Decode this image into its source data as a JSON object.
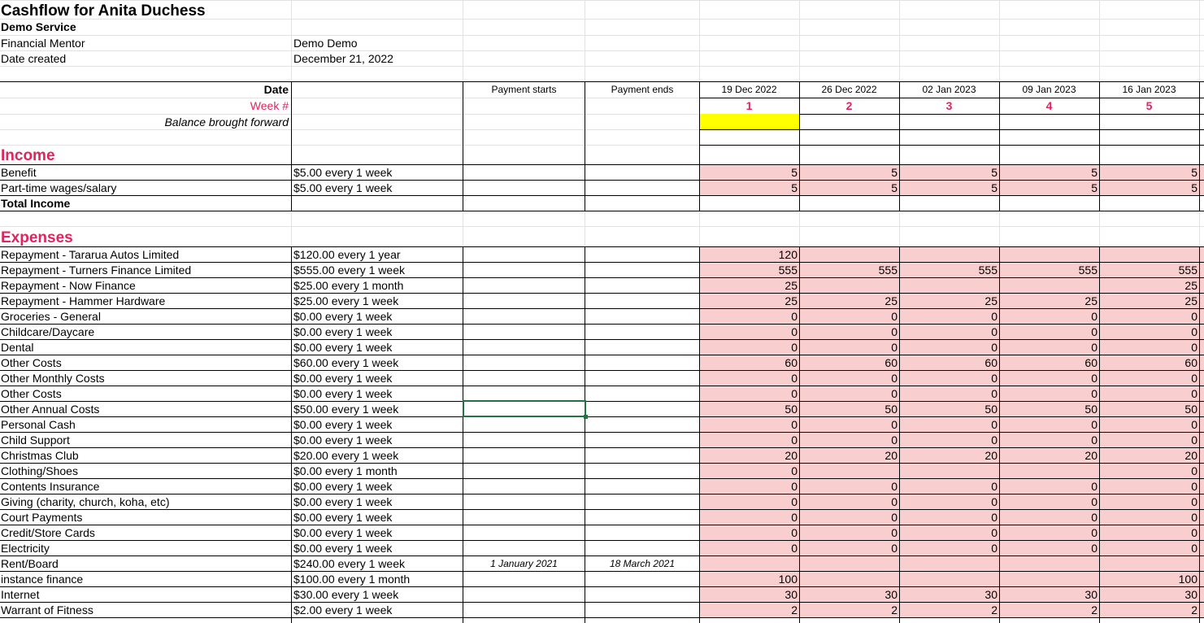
{
  "title": "Cashflow for Anita Duchess",
  "subtitle": "Demo Service",
  "meta": [
    {
      "label": "Financial Mentor",
      "value": "Demo Demo"
    },
    {
      "label": "Date created",
      "value": "December 21, 2022"
    }
  ],
  "header": {
    "date_label": "Date",
    "week_label": "Week #",
    "balance_label": "Balance brought forward",
    "payment_starts": "Payment starts",
    "payment_ends": "Payment ends",
    "weeks": [
      {
        "date": "19 Dec 2022",
        "num": "1"
      },
      {
        "date": "26 Dec 2022",
        "num": "2"
      },
      {
        "date": "02 Jan 2023",
        "num": "3"
      },
      {
        "date": "09 Jan 2023",
        "num": "4"
      },
      {
        "date": "16 Jan 2023",
        "num": "5"
      }
    ]
  },
  "income": {
    "heading": "Income",
    "rows": [
      {
        "name": "Benefit",
        "amount": "$5.00 every 1 week",
        "values": [
          "5",
          "5",
          "5",
          "5",
          "5"
        ]
      },
      {
        "name": "Part-time wages/salary",
        "amount": "$5.00 every 1 week",
        "values": [
          "5",
          "5",
          "5",
          "5",
          "5"
        ]
      }
    ],
    "total_label": "Total Income"
  },
  "expenses": {
    "heading": "Expenses",
    "rows": [
      {
        "name": "Repayment - Tararua Autos Limited",
        "amount": "$120.00 every 1 year",
        "start": "",
        "end": "",
        "values": [
          "120",
          "",
          "",
          "",
          ""
        ]
      },
      {
        "name": "Repayment - Turners Finance Limited",
        "amount": "$555.00 every 1 week",
        "start": "",
        "end": "",
        "values": [
          "555",
          "555",
          "555",
          "555",
          "555"
        ]
      },
      {
        "name": "Repayment - Now Finance",
        "amount": "$25.00 every 1 month",
        "start": "",
        "end": "",
        "values": [
          "25",
          "",
          "",
          "",
          "25"
        ]
      },
      {
        "name": "Repayment - Hammer Hardware",
        "amount": "$25.00 every 1 week",
        "start": "",
        "end": "",
        "values": [
          "25",
          "25",
          "25",
          "25",
          "25"
        ]
      },
      {
        "name": "Groceries - General",
        "amount": "$0.00 every 1 week",
        "start": "",
        "end": "",
        "values": [
          "0",
          "0",
          "0",
          "0",
          "0"
        ]
      },
      {
        "name": "Childcare/Daycare",
        "amount": "$0.00 every 1 week",
        "start": "",
        "end": "",
        "values": [
          "0",
          "0",
          "0",
          "0",
          "0"
        ]
      },
      {
        "name": "Dental",
        "amount": "$0.00 every 1 week",
        "start": "",
        "end": "",
        "values": [
          "0",
          "0",
          "0",
          "0",
          "0"
        ]
      },
      {
        "name": "Other Costs",
        "amount": "$60.00 every 1 week",
        "start": "",
        "end": "",
        "values": [
          "60",
          "60",
          "60",
          "60",
          "60"
        ]
      },
      {
        "name": "Other Monthly Costs",
        "amount": "$0.00 every 1 week",
        "start": "",
        "end": "",
        "values": [
          "0",
          "0",
          "0",
          "0",
          "0"
        ]
      },
      {
        "name": "Other Costs",
        "amount": "$0.00 every 1 week",
        "start": "",
        "end": "",
        "values": [
          "0",
          "0",
          "0",
          "0",
          "0"
        ]
      },
      {
        "name": "Other Annual Costs",
        "amount": "$50.00 every 1 week",
        "start": "",
        "end": "",
        "values": [
          "50",
          "50",
          "50",
          "50",
          "50"
        ]
      },
      {
        "name": "Personal Cash",
        "amount": "$0.00 every 1 week",
        "start": "",
        "end": "",
        "values": [
          "0",
          "0",
          "0",
          "0",
          "0"
        ]
      },
      {
        "name": "Child Support",
        "amount": "$0.00 every 1 week",
        "start": "",
        "end": "",
        "values": [
          "0",
          "0",
          "0",
          "0",
          "0"
        ]
      },
      {
        "name": "Christmas Club",
        "amount": "$20.00 every 1 week",
        "start": "",
        "end": "",
        "values": [
          "20",
          "20",
          "20",
          "20",
          "20"
        ]
      },
      {
        "name": "Clothing/Shoes",
        "amount": "$0.00 every 1 month",
        "start": "",
        "end": "",
        "values": [
          "0",
          "",
          "",
          "",
          "0"
        ]
      },
      {
        "name": "Contents Insurance",
        "amount": "$0.00 every 1 week",
        "start": "",
        "end": "",
        "values": [
          "0",
          "0",
          "0",
          "0",
          "0"
        ]
      },
      {
        "name": "Giving (charity, church, koha, etc)",
        "amount": "$0.00 every 1 week",
        "start": "",
        "end": "",
        "values": [
          "0",
          "0",
          "0",
          "0",
          "0"
        ]
      },
      {
        "name": "Court Payments",
        "amount": "$0.00 every 1 week",
        "start": "",
        "end": "",
        "values": [
          "0",
          "0",
          "0",
          "0",
          "0"
        ]
      },
      {
        "name": "Credit/Store Cards",
        "amount": "$0.00 every 1 week",
        "start": "",
        "end": "",
        "values": [
          "0",
          "0",
          "0",
          "0",
          "0"
        ]
      },
      {
        "name": "Electricity",
        "amount": "$0.00 every 1 week",
        "start": "",
        "end": "",
        "values": [
          "0",
          "0",
          "0",
          "0",
          "0"
        ]
      },
      {
        "name": "Rent/Board",
        "amount": "$240.00 every 1 week",
        "start": "1 January 2021",
        "end": "18 March 2021",
        "values": [
          "",
          "",
          "",
          "",
          ""
        ]
      },
      {
        "name": "instance finance",
        "amount": "$100.00 every 1 month",
        "start": "",
        "end": "",
        "values": [
          "100",
          "",
          "",
          "",
          "100"
        ]
      },
      {
        "name": "Internet",
        "amount": "$30.00 every 1 week",
        "start": "",
        "end": "",
        "values": [
          "30",
          "30",
          "30",
          "30",
          "30"
        ]
      },
      {
        "name": "Warrant of Fitness",
        "amount": "$2.00 every 1 week",
        "start": "",
        "end": "",
        "values": [
          "2",
          "2",
          "2",
          "2",
          "2"
        ]
      }
    ]
  },
  "colors": {
    "accent": "#e0245e",
    "band": "#f9cece",
    "highlight": "#ffff00",
    "selection": "#217346"
  }
}
